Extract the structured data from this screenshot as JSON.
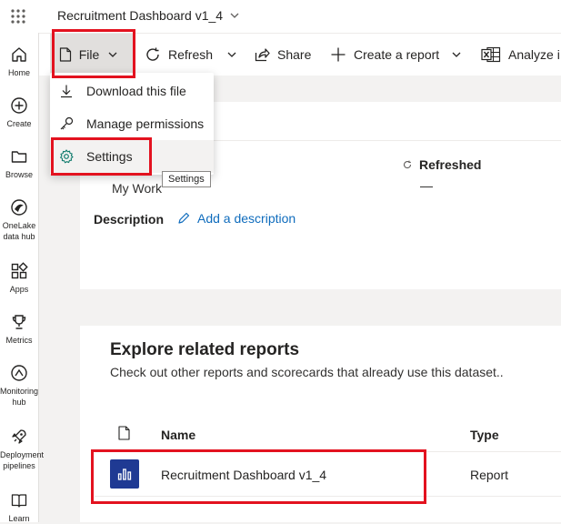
{
  "app": {
    "title": "Recruitment Dashboard v1_4"
  },
  "rail": {
    "items": [
      {
        "label": "Home",
        "icon": "home-icon"
      },
      {
        "label": "Create",
        "icon": "plus-circle-icon"
      },
      {
        "label": "Browse",
        "icon": "folder-icon"
      },
      {
        "label": "OneLake data hub",
        "icon": "onelake-icon"
      },
      {
        "label": "Apps",
        "icon": "apps-icon"
      },
      {
        "label": "Metrics",
        "icon": "trophy-icon"
      },
      {
        "label": "Monitoring hub",
        "icon": "monitoring-icon"
      },
      {
        "label": "Deployment pipelines",
        "icon": "rocket-icon"
      },
      {
        "label": "Learn",
        "icon": "book-icon"
      }
    ]
  },
  "commands": {
    "file": "File",
    "refresh": "Refresh",
    "share": "Share",
    "create_report": "Create a report",
    "analyze": "Analyze i"
  },
  "file_menu": {
    "items": [
      {
        "label": "Download this file",
        "icon": "download-icon"
      },
      {
        "label": "Manage permissions",
        "icon": "key-icon"
      },
      {
        "label": "Settings",
        "icon": "gear-icon"
      }
    ],
    "tooltip": "Settings"
  },
  "details": {
    "workspace_value": "My Work",
    "refreshed_label": "Refreshed",
    "refreshed_value": "—",
    "description_label": "Description",
    "add_description": "Add a description"
  },
  "related": {
    "title": "Explore related reports",
    "subtitle": "Check out other reports and scorecards that already use this dataset..",
    "columns": {
      "name": "Name",
      "type": "Type"
    },
    "rows": [
      {
        "name": "Recruitment Dashboard v1_4",
        "type": "Report",
        "icon": "report-icon"
      }
    ]
  },
  "colors": {
    "highlight": "#e3121f",
    "report_icon_bg": "#1f3a93",
    "link": "#0f6cbd"
  }
}
